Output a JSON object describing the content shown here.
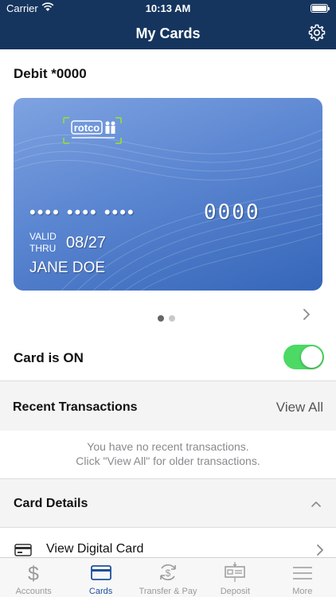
{
  "status_bar": {
    "carrier": "Carrier",
    "time": "10:13 AM"
  },
  "header": {
    "title": "My Cards",
    "settings_icon": "gear-icon"
  },
  "card_section": {
    "title": "Debit *0000",
    "card": {
      "masked_groups": "•••• •••• ••••",
      "last_four": "0000",
      "valid_thru_label_line1": "VALID",
      "valid_thru_label_line2": "THRU",
      "expiry": "08/27",
      "cardholder": "JANE DOE",
      "logo_text": "rotco"
    },
    "pager": {
      "count": 2,
      "active_index": 0
    }
  },
  "card_toggle": {
    "label": "Card is ON",
    "on": true,
    "color": "#4cd964"
  },
  "recent": {
    "title": "Recent Transactions",
    "view_all": "View All",
    "empty_line1": "You have no recent transactions.",
    "empty_line2": "Click \"View All\" for older transactions."
  },
  "details": {
    "title": "Card Details",
    "items": [
      {
        "label": "View Digital Card"
      }
    ]
  },
  "tabs": [
    {
      "label": "Accounts",
      "icon": "dollar-icon",
      "active": false
    },
    {
      "label": "Cards",
      "icon": "card-icon",
      "active": true
    },
    {
      "label": "Transfer & Pay",
      "icon": "transfer-icon",
      "active": false
    },
    {
      "label": "Deposit",
      "icon": "check-deposit-icon",
      "active": false
    },
    {
      "label": "More",
      "icon": "menu-icon",
      "active": false
    }
  ],
  "colors": {
    "header_bg": "#15355e",
    "accent": "#1d4f9a",
    "toggle_on": "#4cd964"
  }
}
